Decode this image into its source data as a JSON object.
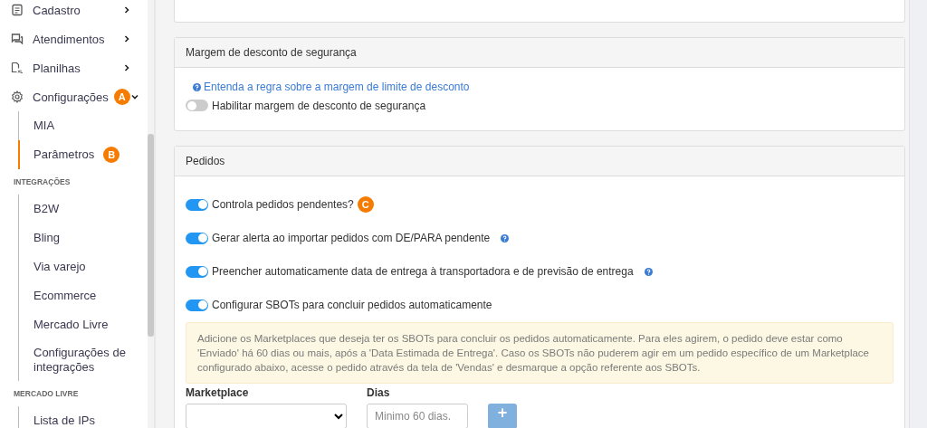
{
  "sidebar": {
    "items": [
      {
        "label": "Cadastro",
        "expanded": false
      },
      {
        "label": "Atendimentos",
        "expanded": false
      },
      {
        "label": "Planilhas",
        "expanded": false
      },
      {
        "label": "Configurações",
        "expanded": true,
        "badge": "A",
        "children": [
          {
            "label": "MIA",
            "selected": false
          },
          {
            "label": "Parâmetros",
            "selected": true,
            "badge": "B"
          }
        ]
      }
    ],
    "sections": [
      {
        "title": "INTEGRAÇÕES",
        "items": [
          {
            "label": "B2W",
            "selected": false
          },
          {
            "label": "Bling",
            "selected": false
          },
          {
            "label": "Via varejo",
            "selected": false
          },
          {
            "label": "Ecommerce",
            "selected": false
          },
          {
            "label": "Mercado Livre",
            "selected": false
          },
          {
            "label": "Configurações de integrações",
            "selected": false
          }
        ]
      },
      {
        "title": "MERCADO LIVRE",
        "items": [
          {
            "label": "Lista de IPs",
            "selected": false
          }
        ]
      }
    ]
  },
  "cards": [
    {
      "title": "Margem de desconto de segurança",
      "help_link": "Entenda a regra sobre a margem de limite de desconto",
      "toggles": [
        {
          "label": "Habilitar margem de desconto de segurança",
          "on": false,
          "help": false
        }
      ]
    },
    {
      "title": "Pedidos",
      "toggles": [
        {
          "label": "Controla pedidos pendentes?",
          "on": true,
          "help": false,
          "badge": "C"
        },
        {
          "label": "Gerar alerta ao importar pedidos com DE/PARA pendente",
          "on": true,
          "help": true
        },
        {
          "label": "Preencher automaticamente data de entrega à transportadora e de previsão de entrega",
          "on": true,
          "help": true
        },
        {
          "label": "Configurar SBOTs para concluir pedidos automaticamente",
          "on": true,
          "help": false
        }
      ],
      "alert": "Adicione os Marketplaces que deseja ter os SBOTs para concluir os pedidos automaticamente. Para eles agirem, o pedido deve estar como 'Enviado' há 60 dias ou mais, após a 'Data Estimada de Entrega'. Caso os SBOTs não puderem agir em um pedido específico de um Marketplace configurado abaixo, acesse o pedido através da tela de 'Vendas' e desmarque a opção referente aos SBOTs.",
      "form": {
        "marketplace_label": "Marketplace",
        "days_label": "Dias",
        "days_placeholder": "Minimo 60 dias.",
        "add_button": "+"
      }
    }
  ]
}
